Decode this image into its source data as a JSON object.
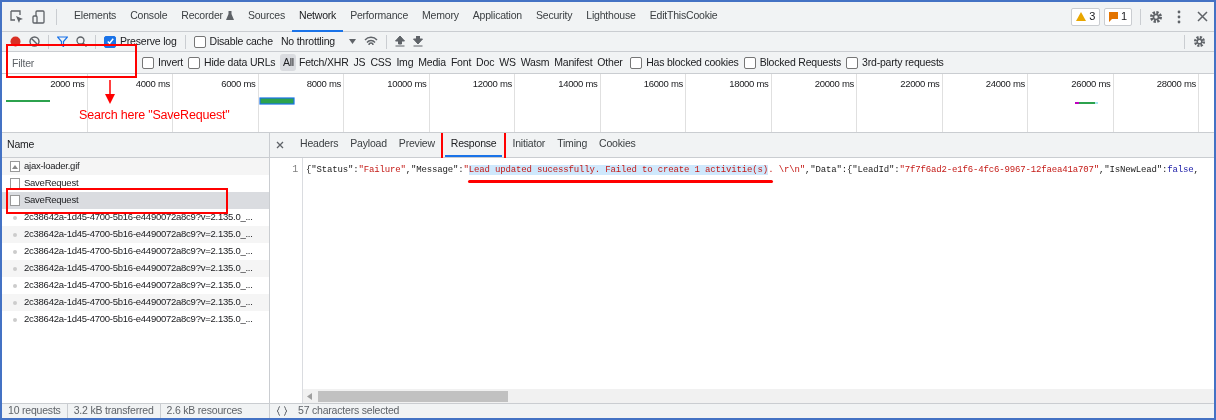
{
  "main_tabs": [
    {
      "label": "Elements",
      "selected": false
    },
    {
      "label": "Console",
      "selected": false
    },
    {
      "label": "Recorder",
      "selected": false,
      "kind": "flask"
    },
    {
      "label": "Sources",
      "selected": false
    },
    {
      "label": "Network",
      "selected": true
    },
    {
      "label": "Performance",
      "selected": false
    },
    {
      "label": "Memory",
      "selected": false
    },
    {
      "label": "Application",
      "selected": false
    },
    {
      "label": "Security",
      "selected": false
    },
    {
      "label": "Lighthouse",
      "selected": false
    },
    {
      "label": "EditThisCookie",
      "selected": false
    }
  ],
  "badges": [
    {
      "kind": "warning",
      "count": "3"
    },
    {
      "kind": "issue",
      "count": "1"
    }
  ],
  "toolbar": {
    "preserve_log": {
      "label": "Preserve log",
      "checked": true
    },
    "disable_cache": {
      "label": "Disable cache",
      "checked": false
    },
    "throttling": "No throttling"
  },
  "filter": {
    "placeholder": "Filter",
    "options": [
      {
        "label": "Invert",
        "checked": false
      },
      {
        "label": "Hide data URLs",
        "checked": false
      }
    ],
    "types": [
      {
        "label": "All",
        "selected": true
      },
      {
        "label": "Fetch/XHR",
        "selected": false
      },
      {
        "label": "JS",
        "selected": false
      },
      {
        "label": "CSS",
        "selected": false
      },
      {
        "label": "Img",
        "selected": false
      },
      {
        "label": "Media",
        "selected": false
      },
      {
        "label": "Font",
        "selected": false
      },
      {
        "label": "Doc",
        "selected": false
      },
      {
        "label": "WS",
        "selected": false
      },
      {
        "label": "Wasm",
        "selected": false
      },
      {
        "label": "Manifest",
        "selected": false
      },
      {
        "label": "Other",
        "selected": false
      }
    ],
    "extra_options": [
      {
        "label": "Has blocked cookies",
        "checked": false
      },
      {
        "label": "Blocked Requests",
        "checked": false
      },
      {
        "label": "3rd-party requests",
        "checked": false
      }
    ]
  },
  "overview": {
    "ticks": [
      "2000 ms",
      "4000 ms",
      "6000 ms",
      "8000 ms",
      "10000 ms",
      "12000 ms",
      "14000 ms",
      "16000 ms",
      "18000 ms",
      "20000 ms",
      "22000 ms",
      "24000 ms",
      "26000 ms",
      "28000 ms"
    ]
  },
  "annotation": {
    "text": "Search here \"SaveRequest\""
  },
  "requests": {
    "header": "Name",
    "rows": [
      {
        "name": "ajax-loader.gif",
        "kind": "image",
        "selected": false
      },
      {
        "name": "SaveRequest",
        "kind": "document",
        "selected": false
      },
      {
        "name": "SaveRequest",
        "kind": "document",
        "selected": true
      },
      {
        "name": "2c38642a-1d45-4700-5b16-e4490072a8c9?v=2.135.0_...",
        "kind": "script",
        "selected": false
      },
      {
        "name": "2c38642a-1d45-4700-5b16-e4490072a8c9?v=2.135.0_...",
        "kind": "script",
        "selected": false
      },
      {
        "name": "2c38642a-1d45-4700-5b16-e4490072a8c9?v=2.135.0_...",
        "kind": "script",
        "selected": false
      },
      {
        "name": "2c38642a-1d45-4700-5b16-e4490072a8c9?v=2.135.0_...",
        "kind": "script",
        "selected": false
      },
      {
        "name": "2c38642a-1d45-4700-5b16-e4490072a8c9?v=2.135.0_...",
        "kind": "script",
        "selected": false
      },
      {
        "name": "2c38642a-1d45-4700-5b16-e4490072a8c9?v=2.135.0_...",
        "kind": "script",
        "selected": false
      },
      {
        "name": "2c38642a-1d45-4700-5b16-e4490072a8c9?v=2.135.0_...",
        "kind": "script",
        "selected": false
      }
    ]
  },
  "detail_tabs": [
    {
      "label": "Headers",
      "selected": false
    },
    {
      "label": "Payload",
      "selected": false
    },
    {
      "label": "Preview",
      "selected": false
    },
    {
      "label": "Response",
      "selected": true
    },
    {
      "label": "Initiator",
      "selected": false
    },
    {
      "label": "Timing",
      "selected": false
    },
    {
      "label": "Cookies",
      "selected": false
    }
  ],
  "response": {
    "line_number": "1",
    "tokens": [
      {
        "text": "{\"Status\":",
        "kind": "plain"
      },
      {
        "text": "\"Failure\"",
        "kind": "string"
      },
      {
        "text": ",\"Message\":",
        "kind": "plain"
      },
      {
        "text": "\"",
        "kind": "string"
      },
      {
        "text": "Lead updated sucessfully. Failed to create 1 activitie(s)",
        "kind": "selected"
      },
      {
        "text": ". \\r\\n\"",
        "kind": "string"
      },
      {
        "text": ",\"Data\":{\"LeadId\":",
        "kind": "plain"
      },
      {
        "text": "\"7f7f6ad2-e1f6-4fc6-9967-12faea41a707\"",
        "kind": "string"
      },
      {
        "text": ",\"IsNewLead\":",
        "kind": "plain"
      },
      {
        "text": "false",
        "kind": "literal"
      },
      {
        "text": ",",
        "kind": "plain"
      }
    ]
  },
  "status_bar": {
    "left": [
      "10 requests",
      "3.2 kB transferred",
      "2.6 kB resources"
    ],
    "right": "57 characters selected"
  }
}
